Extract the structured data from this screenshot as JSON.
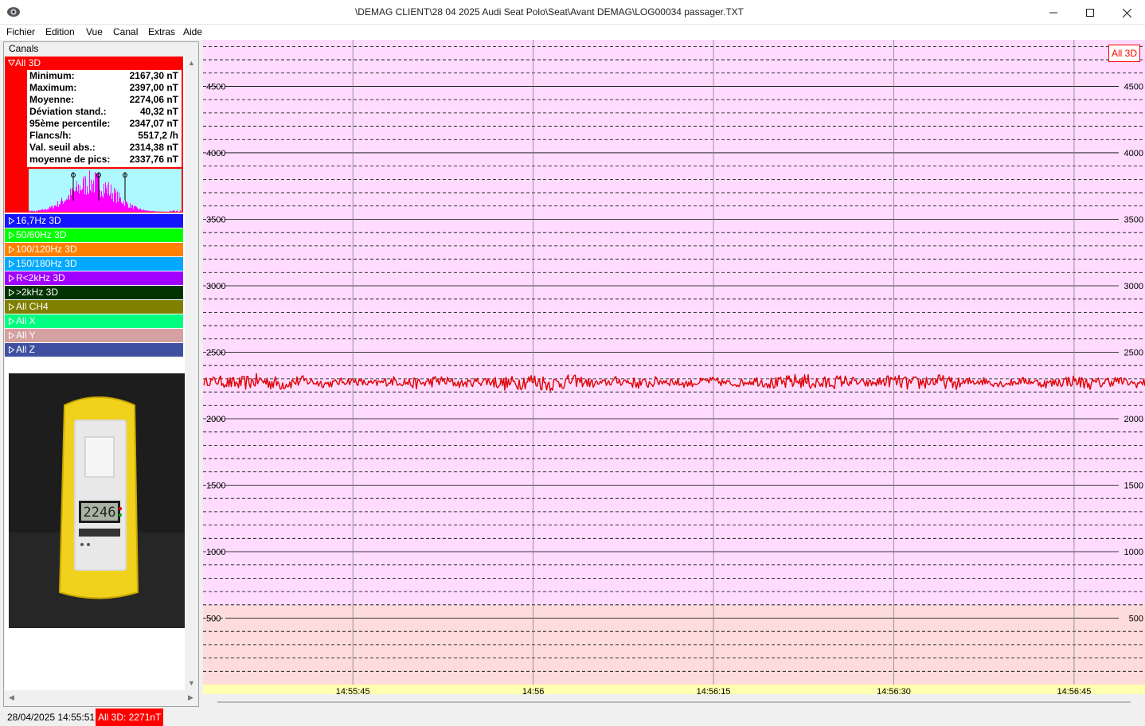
{
  "window": {
    "title": "\\DEMAG CLIENT\\28 04 2025 Audi Seat Polo\\Seat\\Avant DEMAG\\LOG00034 passager.TXT",
    "minimize_icon": "minimize-icon",
    "maximize_icon": "maximize-icon",
    "close_icon": "close-icon"
  },
  "menu": [
    "Fichier",
    "Edition",
    "Vue",
    "Canal",
    "Extras",
    "Aide"
  ],
  "canals": {
    "header": "Canals",
    "expanded": {
      "name": "All 3D",
      "color": "#ff0000",
      "stats": [
        {
          "label": "Minimum:",
          "value": "2167,30 nT"
        },
        {
          "label": "Maximum:",
          "value": "2397,00 nT"
        },
        {
          "label": "Moyenne:",
          "value": "2274,06 nT"
        },
        {
          "label": "Déviation stand.:",
          "value": "40,32 nT"
        },
        {
          "label": "95ème percentile:",
          "value": "2347,07 nT"
        },
        {
          "label": "Flancs/h:",
          "value": "5517,2 /h"
        },
        {
          "label": "Val. seuil abs.:",
          "value": "2314,38 nT"
        },
        {
          "label": "moyenne de pics:",
          "value": "2337,76 nT"
        }
      ]
    },
    "items": [
      {
        "name": "16,7Hz 3D",
        "color": "#1414ff",
        "text": "#ffffff"
      },
      {
        "name": "50/60Hz 3D",
        "color": "#00ff00",
        "text": "#ffffff"
      },
      {
        "name": "100/120Hz 3D",
        "color": "#ff8000",
        "text": "#ffffff"
      },
      {
        "name": "150/180Hz 3D",
        "color": "#00a8ff",
        "text": "#ffffff"
      },
      {
        "name": "R<2kHz 3D",
        "color": "#a000ff",
        "text": "#ffffff"
      },
      {
        "name": ">2kHz 3D",
        "color": "#003300",
        "text": "#ffffff"
      },
      {
        "name": "All CH4",
        "color": "#808000",
        "text": "#ffffff"
      },
      {
        "name": "All X",
        "color": "#00ff80",
        "text": "#ffffff"
      },
      {
        "name": "All Y",
        "color": "#d4a0a0",
        "text": "#ffffff"
      },
      {
        "name": "All Z",
        "color": "#4050a0",
        "text": "#ffffff"
      }
    ],
    "photo_display": "2246"
  },
  "chart_data": {
    "type": "line",
    "series": [
      {
        "name": "All 3D",
        "color": "#e00000"
      }
    ],
    "y_ticks": [
      500,
      1000,
      1500,
      2000,
      2500,
      3000,
      3500,
      4000,
      4500
    ],
    "ylim": [
      0,
      4850
    ],
    "x_ticks": [
      "14:55:45",
      "14:56",
      "14:56:15",
      "14:56:30",
      "14:56:45"
    ],
    "xlim": [
      "14:55:32.6",
      "14:56:50.9"
    ],
    "signal": {
      "mean": 2274.06,
      "min": 2167.3,
      "max": 2397.0
    },
    "background_bands": [
      {
        "from": 0,
        "to": 600,
        "color": "#ffdcdc"
      },
      {
        "from": 600,
        "to": 4850,
        "color": "#ffdcff"
      }
    ],
    "legend": "All 3D"
  },
  "status": {
    "datetime": "28/04/2025 14:55:51",
    "value": "All 3D: 2271nT"
  }
}
